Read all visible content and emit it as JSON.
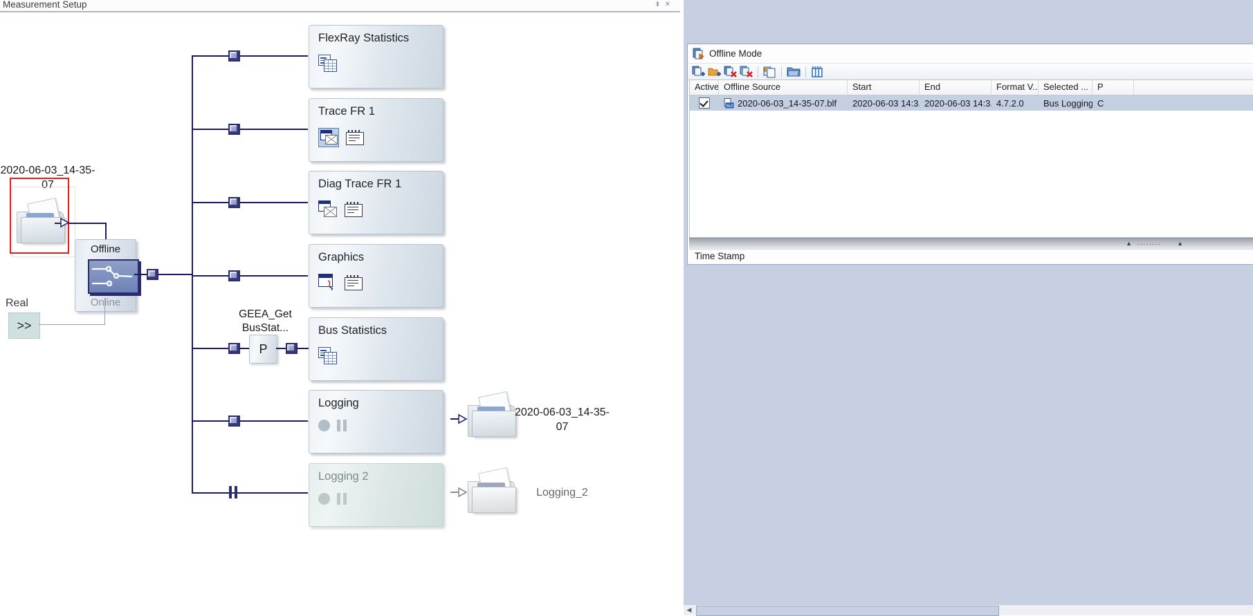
{
  "window": {
    "title": "Measurement Setup",
    "pin_icon": "pin-icon",
    "close_icon": "close-icon"
  },
  "diagram": {
    "source_node": {
      "label": "2020-06-03_14-35-07",
      "icon": "folder-file-icon",
      "selected": true
    },
    "switch": {
      "top_label": "Offline",
      "bottom_label": "Online",
      "icon": "toggle-switch-icon"
    },
    "real_label": "Real",
    "real_button": ">>",
    "blocks": [
      {
        "name": "FlexRay Statistics",
        "icons": [
          "statistics-icon"
        ],
        "enabled": true
      },
      {
        "name": "Trace FR 1",
        "icons": [
          "trace-window-icon",
          "list-config-icon"
        ],
        "enabled": true
      },
      {
        "name": "Diag Trace FR 1",
        "icons": [
          "diag-trace-icon",
          "list-config-icon"
        ],
        "enabled": true
      },
      {
        "name": "Graphics",
        "icons": [
          "graphics-window-icon",
          "list-config-icon"
        ],
        "enabled": true
      },
      {
        "name": "Bus Statistics",
        "icons": [
          "statistics-icon"
        ],
        "enabled": true
      },
      {
        "name": "Logging",
        "icons": [
          "record-icon",
          "pause-icon"
        ],
        "enabled": true
      },
      {
        "name": "Logging 2",
        "icons": [
          "record-icon",
          "pause-icon"
        ],
        "enabled": false
      }
    ],
    "program_node": {
      "label": "P",
      "caption": "GEEA_Get BusStat..."
    },
    "outputs": [
      {
        "label": "2020-06-03_14-35-07",
        "icon": "folder-file-icon",
        "enabled": true
      },
      {
        "label": "Logging_2",
        "icon": "folder-file-icon",
        "enabled": false
      }
    ]
  },
  "offline_panel": {
    "title": "Offline Mode",
    "title_icon": "offline-mode-icon",
    "toolbar": [
      {
        "name": "add-offline-source-icon",
        "tip": "Add Offline Source"
      },
      {
        "name": "add-folder-icon",
        "tip": "Add Folder"
      },
      {
        "name": "remove-source-icon",
        "tip": "Remove Source"
      },
      {
        "name": "remove-all-icon",
        "tip": "Remove All"
      },
      {
        "name": "copy-source-icon",
        "tip": "Copy"
      },
      {
        "name": "open-folder-icon",
        "tip": "Open Folder"
      },
      {
        "name": "columns-icon",
        "tip": "Configure Columns"
      }
    ],
    "columns": [
      "Active",
      "Offline Source",
      "Start",
      "End",
      "Format V...",
      "Selected ...",
      "P"
    ],
    "rows": [
      {
        "active": true,
        "source": "2020-06-03_14-35-07.blf",
        "source_icon": "blf-file-icon",
        "start": "2020-06-03 14:3...",
        "end": "2020-06-03 14:3...",
        "format_version": "4.7.2.0",
        "selected": "Bus Logging",
        "p": "C"
      }
    ],
    "footer": "Time Stamp",
    "splitter_grip": "········"
  },
  "colors": {
    "wire": "#1b1b60",
    "selection": "#e02020",
    "row_selected": "#c4d0e2",
    "panel_bg": "#c6d0e2"
  }
}
